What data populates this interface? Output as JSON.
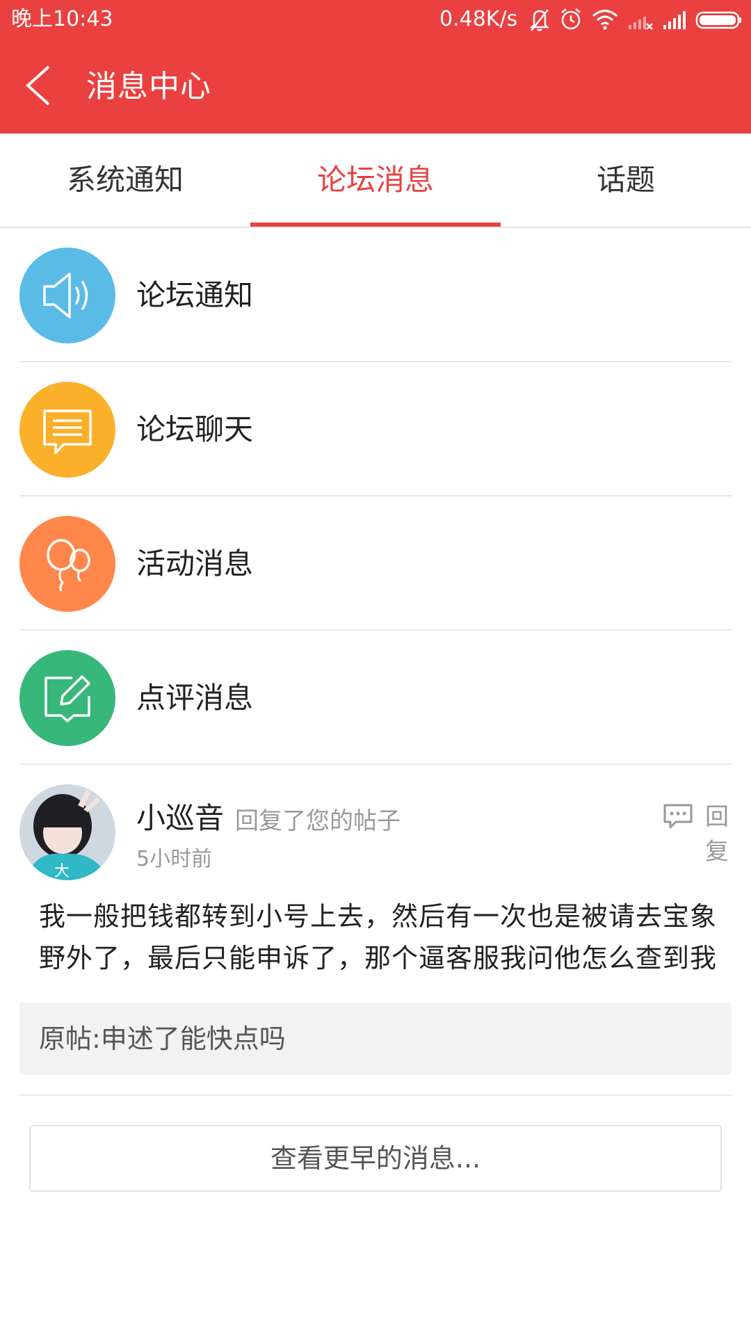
{
  "status_bar": {
    "time": "晚上10:43",
    "speed": "0.48K/s",
    "icons": [
      "bell-muted-icon",
      "alarm-icon",
      "wifi-icon",
      "signal-none-icon",
      "signal-full-icon",
      "battery-icon"
    ]
  },
  "header": {
    "title": "消息中心",
    "back_icon": "chevron-left-icon",
    "background": "#ea4040"
  },
  "tabs": [
    {
      "label": "系统通知",
      "active": false
    },
    {
      "label": "论坛消息",
      "active": true
    },
    {
      "label": "话题",
      "active": false
    }
  ],
  "categories": [
    {
      "label": "论坛通知",
      "icon": "speaker-icon",
      "color": "#5bbbe7"
    },
    {
      "label": "论坛聊天",
      "icon": "chat-icon",
      "color": "#fbb02c"
    },
    {
      "label": "活动消息",
      "icon": "balloon-icon",
      "color": "#ff874c"
    },
    {
      "label": "点评消息",
      "icon": "edit-icon",
      "color": "#37b77a"
    }
  ],
  "reply": {
    "user": "小巡音",
    "action": "回复了您的帖子",
    "time": "5小时前",
    "reply_label": "回复",
    "body": "我一般把钱都转到小号上去，然后有一次也是被请去宝象野外了，最后只能申诉了，那个逼客服我问他怎么查到我",
    "quote": "原帖:申述了能快点吗"
  },
  "more_button": "查看更早的消息...",
  "accent_color": "#e54343"
}
